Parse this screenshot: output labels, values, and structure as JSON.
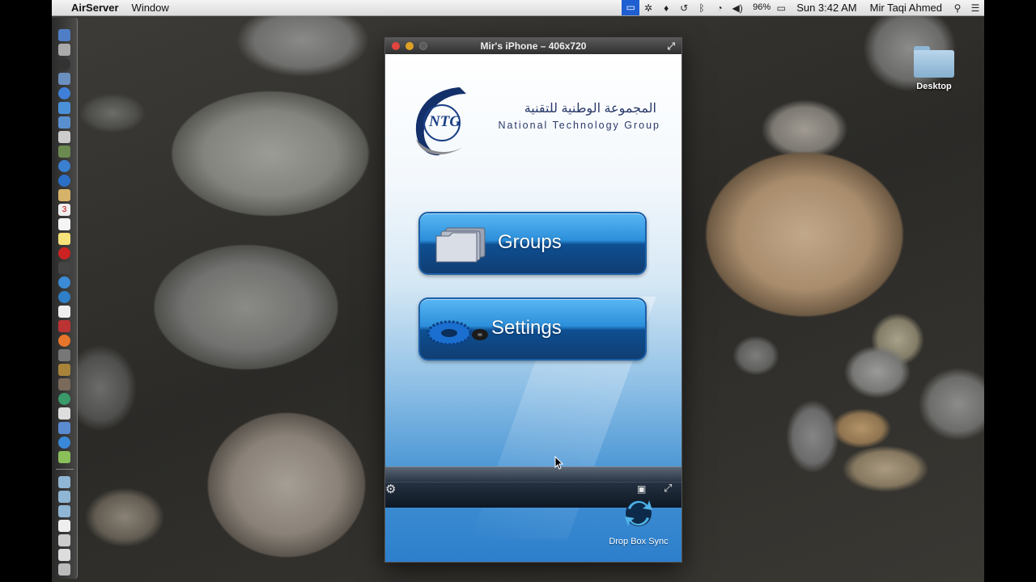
{
  "menubar": {
    "apple_glyph": "",
    "app_name": "AirServer",
    "menus": [
      "Window"
    ],
    "battery": "96%",
    "clock": "Sun 3:42 AM",
    "user": "Mir Taqi Ahmed"
  },
  "window": {
    "title": "Mir's iPhone – 406x720"
  },
  "app": {
    "logo": {
      "abbr": "NTG",
      "arabic": "المجموعة الوطنية للتقنية",
      "english": "National Technology Group"
    },
    "buttons": [
      {
        "label": "Groups",
        "icon": "folders-icon"
      },
      {
        "label": "Settings",
        "icon": "gear-icon"
      }
    ],
    "dropbox_label": "Drop Box Sync"
  },
  "desktop": {
    "folder_label": "Desktop"
  },
  "colors": {
    "button_blue": "#2c8fda",
    "toolbar_dark": "#243040",
    "menu_highlight": "#1f5fd1"
  }
}
